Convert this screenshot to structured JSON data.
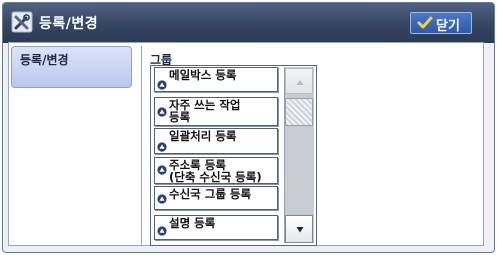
{
  "window": {
    "title": "등록/변경",
    "title_icon": "tools-icon",
    "close_label": "닫기",
    "close_icon": "checkmark-icon",
    "accent_color": "#2f5aa6"
  },
  "sidebar": {
    "active_tab": "등록/변경"
  },
  "panel": {
    "label": "그룹",
    "items": [
      {
        "lines": [
          "메일박스 등록"
        ]
      },
      {
        "lines": [
          "자주 쓰는 작업",
          "등록"
        ]
      },
      {
        "lines": [
          "일괄처리 등록"
        ]
      },
      {
        "lines": [
          "주소록 등록",
          "(단축 수신국 등록)"
        ]
      },
      {
        "lines": [
          "수신국 그룹 등록"
        ]
      },
      {
        "lines": [
          "설명 등록"
        ]
      }
    ]
  },
  "scrollbar": {
    "up_icon": "scroll-up-arrow-icon",
    "down_icon": "scroll-down-arrow-icon"
  }
}
